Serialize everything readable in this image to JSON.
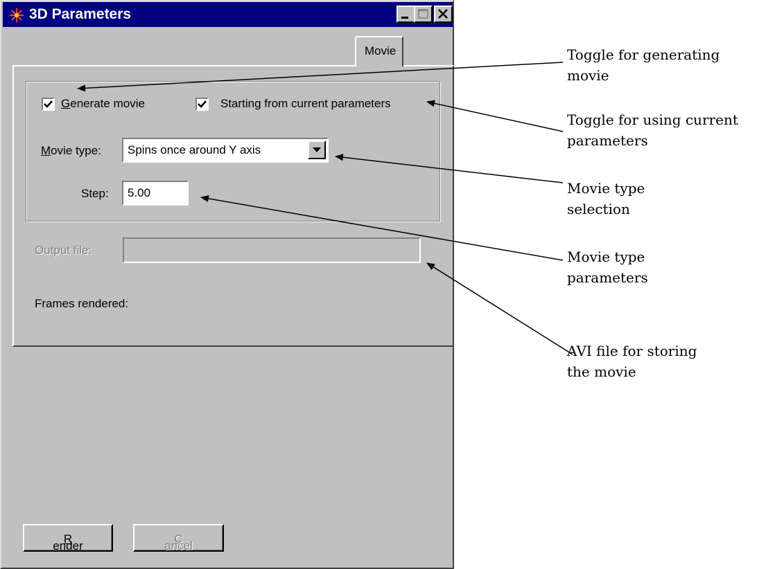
{
  "window": {
    "title": "3D Parameters",
    "controls": {
      "minimize": "minimize-icon",
      "maximize": "maximize-icon",
      "close": "close-icon"
    }
  },
  "tabs": [
    {
      "label": "Movie",
      "active": true
    }
  ],
  "movie": {
    "generate_movie": {
      "label_accel": "G",
      "label_rest": "enerate movie",
      "checked": true
    },
    "starting_from_current": {
      "label": "Starting from current parameters",
      "checked": true
    },
    "movie_type": {
      "label_accel": "M",
      "label_rest": "ovie type:",
      "value": "Spins once around Y axis"
    },
    "step": {
      "label": "Step:",
      "value": "5.00"
    },
    "output_file": {
      "label": "Output file:",
      "value": "",
      "disabled": true
    },
    "frames_rendered": {
      "label": "Frames rendered:"
    }
  },
  "buttons": {
    "render": {
      "accel": "R",
      "rest": "ender",
      "disabled": false
    },
    "cancel": {
      "accel": "C",
      "rest": "ancel",
      "disabled": true
    }
  },
  "annotations": [
    {
      "lines": [
        "Toggle for generating",
        "movie"
      ]
    },
    {
      "lines": [
        "Toggle for using current",
        "parameters"
      ]
    },
    {
      "lines": [
        "Movie type",
        "selection"
      ]
    },
    {
      "lines": [
        "Movie type",
        "parameters"
      ]
    },
    {
      "lines": [
        "AVI file for storing",
        "the movie"
      ]
    }
  ],
  "colors": {
    "titlebar": "#000080",
    "face": "#c0c0c0",
    "disabled_text": "#808080"
  }
}
